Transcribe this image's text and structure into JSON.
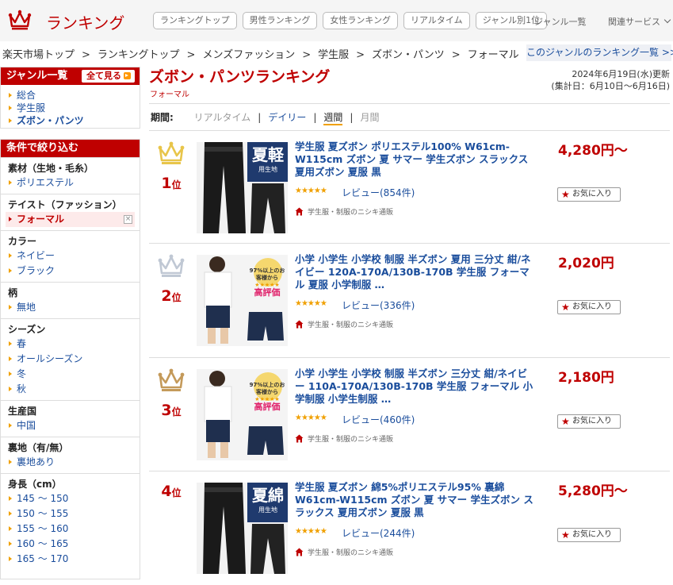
{
  "header": {
    "logo_text": "ランキング",
    "tabs": [
      "ランキングトップ",
      "男性ランキング",
      "女性ランキング",
      "リアルタイム",
      "ジャンル別1位"
    ],
    "genre_list_link": "ジャンル一覧",
    "related_services": "関連サービス"
  },
  "breadcrumb": [
    "楽天市場トップ",
    "ランキングトップ",
    "メンズファッション",
    "学生服",
    "ズボン・パンツ",
    "フォーマル"
  ],
  "breadcrumb_sep": ">",
  "genre_ranking_link": "このジャンルのランキング一覧 >>",
  "sidebar": {
    "genre_title": "ジャンル一覧",
    "all_view": "全て見る",
    "genres": [
      "総合",
      "学生服",
      "ズボン・パンツ"
    ],
    "filter_title": "条件で絞り込む",
    "filters": [
      {
        "title": "素材（生地・毛糸）",
        "items": [
          "ポリエステル"
        ]
      },
      {
        "title": "テイスト（ファッション）",
        "items": [
          "フォーマル"
        ]
      },
      {
        "title": "カラー",
        "items": [
          "ネイビー",
          "ブラック"
        ]
      },
      {
        "title": "柄",
        "items": [
          "無地"
        ]
      },
      {
        "title": "シーズン",
        "items": [
          "春",
          "オールシーズン",
          "冬",
          "秋"
        ]
      },
      {
        "title": "生産国",
        "items": [
          "中国"
        ]
      },
      {
        "title": "裏地（有/無）",
        "items": [
          "裏地あり"
        ]
      },
      {
        "title": "身長（cm）",
        "items": [
          "145 〜 150",
          "150 〜 155",
          "155 〜 160",
          "160 〜 165",
          "165 〜 170"
        ]
      }
    ],
    "remove_mark": "×"
  },
  "main": {
    "title": "ズボン・パンツランキング",
    "subtitle": "フォーマル",
    "updated": "2024年6月19日(水)更新",
    "period_range": "(集計日：6月10日〜6月16日)",
    "period_label": "期間:",
    "periods": [
      "リアルタイム",
      "デイリー",
      "週間",
      "月間"
    ],
    "period_sep": "|"
  },
  "items": [
    {
      "rank": "1",
      "rank_suffix": "位",
      "title": "学生服 夏ズボン ポリエステル100% W61cm-W115cm ズボン 夏 サマー 学生ズボン スラックス 夏用ズボン 夏服 黒",
      "stars": "★★★★★",
      "review": "レビュー(854件)",
      "shop": "学生服・制服のニシキ通販",
      "price": "4,280円〜",
      "fav": "お気に入り",
      "crown_color": "#e8c54a"
    },
    {
      "rank": "2",
      "rank_suffix": "位",
      "title": "小学 小学生 小学校 制服 半ズボン 夏用 三分丈 紺/ネイビー 120A-170A/130B-170B 学生服 フォーマル 夏服 小学制服 …",
      "stars": "★★★★★",
      "review": "レビュー(336件)",
      "shop": "学生服・制服のニシキ通販",
      "price": "2,020円",
      "fav": "お気に入り",
      "crown_color": "#c0c8d4"
    },
    {
      "rank": "3",
      "rank_suffix": "位",
      "title": "小学 小学生 小学校 制服 半ズボン 三分丈 紺/ネイビー 110A-170A/130B-170B 学生服 フォーマル 小学制服 小学生制服 …",
      "stars": "★★★★★",
      "review": "レビュー(460件)",
      "shop": "学生服・制服のニシキ通販",
      "price": "2,180円",
      "fav": "お気に入り",
      "crown_color": "#c49a5a"
    },
    {
      "rank": "4",
      "rank_suffix": "位",
      "title": "学生服 夏ズボン 綿5%ポリエステル95% 裏綿 W61cm-W115cm ズボン 夏 サマー 学生ズボン スラックス 夏用ズボン 夏服 黒",
      "stars": "★★★★★",
      "review": "レビュー(244件)",
      "shop": "学生服・制服のニシキ通販",
      "price": "5,280円〜",
      "fav": "お気に入り",
      "crown_color": ""
    }
  ],
  "thumbs": [
    {
      "badge": "夏",
      "badge2": "軽",
      "sub": "用生地"
    },
    {
      "note": "97%以上のお客様から",
      "stars": "★★★★★",
      "note2": "高評価"
    },
    {
      "note": "97%以上のお客様から",
      "stars": "★★★★★",
      "note2": "高評価"
    },
    {
      "badge": "夏",
      "badge2": "綿",
      "sub": "用生地"
    }
  ]
}
